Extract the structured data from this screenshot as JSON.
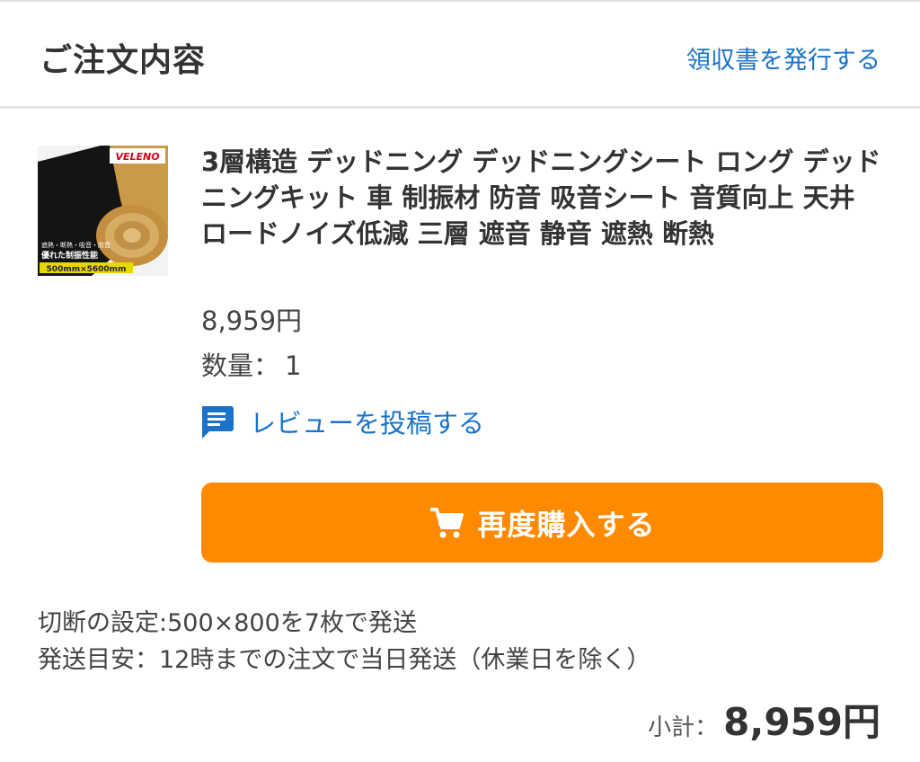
{
  "header": {
    "title": "ご注文内容",
    "receipt_link": "領収書を発行する"
  },
  "item": {
    "image": {
      "brand_logo_text": "VELENO",
      "caption_line1": "遮熱・断熱・吸音・防音",
      "caption_line2": "優れた制振性能",
      "size_badge": "500mm×5600mm"
    },
    "title": "3層構造 デッドニング デッドニングシート ロング デッドニングキット 車 制振材 防音 吸音シート 音質向上 天井 ロードノイズ低減 三層 遮音 静音 遮熱 断熱",
    "price": "8,959円",
    "quantity_label": "数量：",
    "quantity_value": "1",
    "review_label": "レビューを投稿する",
    "rebuy_label": "再度購入する"
  },
  "notes": {
    "cut_setting": "切断の設定:500×800を7枚で発送",
    "shipping_estimate": "発送目安：12時までの注文で当日発送（休業日を除く）"
  },
  "subtotal": {
    "label": "小計：",
    "value": "8,959円"
  },
  "colors": {
    "link": "#1a73c8",
    "button": "#ff8a00",
    "text": "#333333"
  },
  "icons": {
    "review": "chat-bubble-icon",
    "rebuy": "cart-icon"
  }
}
